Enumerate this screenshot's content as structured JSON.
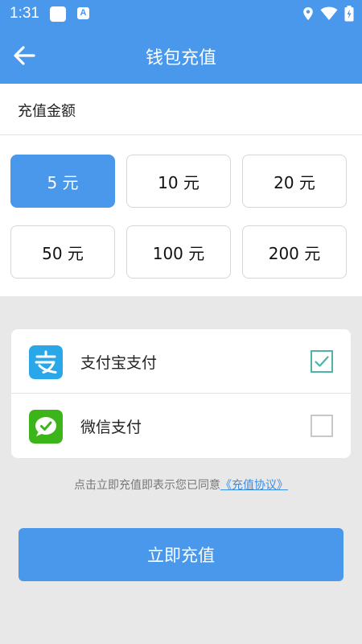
{
  "status_bar": {
    "time": "1:31",
    "a_glyph": "A"
  },
  "app_bar": {
    "title": "钱包充值",
    "back_icon": "arrow-left-icon"
  },
  "amount": {
    "label": "充值金额",
    "options": [
      "5 元",
      "10 元",
      "20 元",
      "50 元",
      "100 元",
      "200 元"
    ],
    "selected_index": 0
  },
  "payment": {
    "methods": [
      {
        "label": "支付宝支付",
        "icon": "alipay-icon",
        "checked": true
      },
      {
        "label": "微信支付",
        "icon": "wechat-icon",
        "checked": false
      }
    ]
  },
  "agreement": {
    "text": "点击立即充值即表示您已同意",
    "link": "《充值协议》"
  },
  "submit": {
    "label": "立即充值"
  },
  "colors": {
    "primary": "#4a98ec",
    "alipay": "#2aa7e8",
    "wechat": "#3cb51b",
    "check": "#4fb3a8",
    "background": "#e8e8e8"
  }
}
